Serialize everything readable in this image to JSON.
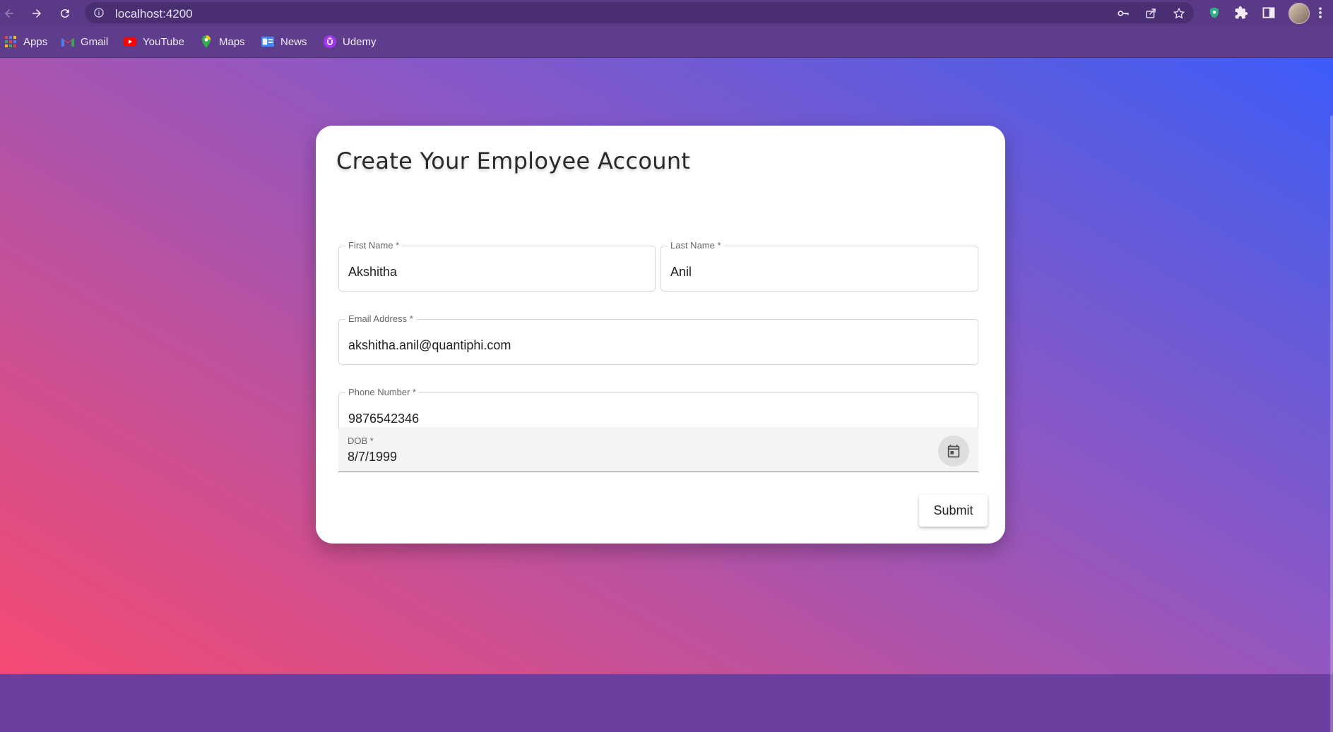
{
  "browser": {
    "url": "localhost:4200",
    "bookmarks": [
      {
        "label": "Apps",
        "icon": "apps-grid-icon"
      },
      {
        "label": "Gmail",
        "icon": "gmail-icon"
      },
      {
        "label": "YouTube",
        "icon": "youtube-icon"
      },
      {
        "label": "Maps",
        "icon": "maps-icon"
      },
      {
        "label": "News",
        "icon": "news-icon"
      },
      {
        "label": "Udemy",
        "icon": "udemy-icon"
      }
    ]
  },
  "form": {
    "title": "Create Your Employee Account",
    "first_name": {
      "label": "First Name *",
      "value": "Akshitha"
    },
    "last_name": {
      "label": "Last Name *",
      "value": "Anil"
    },
    "email": {
      "label": "Email Address *",
      "value": "akshitha.anil@quantiphi.com"
    },
    "phone": {
      "label": "Phone Number *",
      "value": "9876542346"
    },
    "dob": {
      "label": "DOB *",
      "value": "8/7/1999"
    },
    "submit_label": "Submit"
  },
  "colors": {
    "gradient_start": "#f54a72",
    "gradient_end": "#3d5cfa",
    "toolbar": "#5a3a86"
  }
}
